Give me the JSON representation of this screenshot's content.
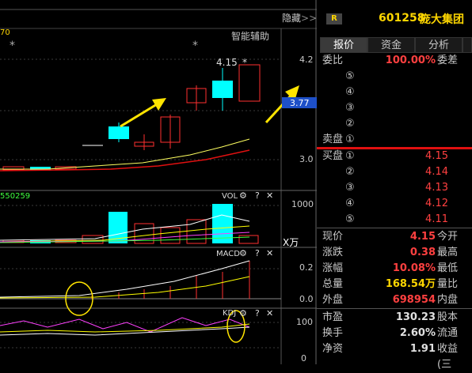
{
  "top_bar": {
    "hide_label": "隐藏",
    "hide_arrows": ">>"
  },
  "main_chart": {
    "partial_label": "70",
    "assist_label": "智能辅助",
    "high_label": "4.15",
    "markers": [
      "*",
      "*",
      "*"
    ],
    "y_ticks": [
      "4.2",
      "3.0"
    ],
    "price_tag": "3.77"
  },
  "vol_panel": {
    "partial_value": "550259",
    "title": "VOL",
    "y_ticks": [
      "1000"
    ],
    "unit": "X万"
  },
  "macd_panel": {
    "title": "MACD",
    "y_ticks": [
      "0.2",
      "0.0"
    ]
  },
  "kdj_panel": {
    "title": "KDJ",
    "y_ticks": [
      "100",
      "0"
    ]
  },
  "panel_icons": {
    "settings": "⚙",
    "help": "?",
    "close": "✕"
  },
  "stock": {
    "badge": "R",
    "code": "601258",
    "name": "庞大集团"
  },
  "tabs": [
    "报价",
    "资金",
    "分析"
  ],
  "order_book": {
    "weibi_label": "委比",
    "weibi_value": "100.00%",
    "weicha_label": "委差",
    "sell_label": "卖盘",
    "sell": [
      {
        "num": "⑤",
        "price": ""
      },
      {
        "num": "④",
        "price": ""
      },
      {
        "num": "③",
        "price": ""
      },
      {
        "num": "②",
        "price": ""
      },
      {
        "num": "①",
        "price": ""
      }
    ],
    "buy_label": "买盘",
    "buy": [
      {
        "num": "①",
        "price": "4.15"
      },
      {
        "num": "②",
        "price": "4.14"
      },
      {
        "num": "③",
        "price": "4.13"
      },
      {
        "num": "④",
        "price": "4.12"
      },
      {
        "num": "⑤",
        "price": "4.11"
      }
    ]
  },
  "quote": [
    {
      "label": "现价",
      "value": "4.15",
      "color": "#ff4040",
      "label2": "今开"
    },
    {
      "label": "涨跌",
      "value": "0.38",
      "color": "#ff4040",
      "label2": "最高"
    },
    {
      "label": "涨幅",
      "value": "10.08%",
      "color": "#ff4040",
      "label2": "最低"
    },
    {
      "label": "总量",
      "value": "168.54万",
      "color": "#ffd700",
      "label2": "量比"
    },
    {
      "label": "外盘",
      "value": "698954",
      "color": "#ff4040",
      "label2": "内盘"
    },
    {
      "label": "市盈",
      "value": "130.23",
      "color": "#e0e0e0",
      "label2": "股本"
    },
    {
      "label": "换手",
      "value": "2.60%",
      "color": "#e0e0e0",
      "label2": "流通"
    },
    {
      "label": "净资",
      "value": "1.91",
      "color": "#e0e0e0",
      "label2": "收益(三"
    }
  ],
  "colors": {
    "up": "#ff3030",
    "down": "#00ffff",
    "accent_blue": "#1e50c8",
    "separator": "#e01010"
  }
}
